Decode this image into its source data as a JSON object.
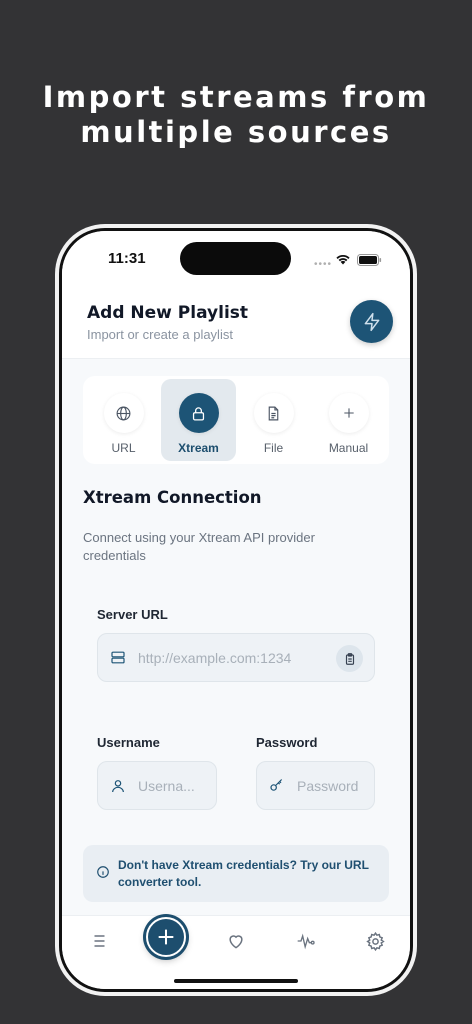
{
  "promo": {
    "line1": "Import streams from",
    "line2": "multiple sources"
  },
  "status": {
    "time": "11:31",
    "dots": "••••"
  },
  "header": {
    "title": "Add New Playlist",
    "subtitle": "Import or create a playlist",
    "action_icon": "bolt-icon"
  },
  "tabs": [
    {
      "label": "URL",
      "icon": "globe-icon",
      "active": false
    },
    {
      "label": "Xtream",
      "icon": "lock-icon",
      "active": true
    },
    {
      "label": "File",
      "icon": "file-icon",
      "active": false
    },
    {
      "label": "Manual",
      "icon": "plus-icon",
      "active": false
    }
  ],
  "section": {
    "title": "Xtream Connection",
    "description": "Connect using your Xtream API provider credentials"
  },
  "form": {
    "server_url": {
      "label": "Server URL",
      "placeholder": "http://example.com:1234"
    },
    "username": {
      "label": "Username",
      "placeholder": "Userna..."
    },
    "password": {
      "label": "Password",
      "placeholder": "Password"
    }
  },
  "info": {
    "text": "Don't have Xtream credentials? Try our URL converter tool."
  },
  "nav": [
    "list-icon",
    "add-icon",
    "heart-icon",
    "activity-icon",
    "settings-icon"
  ],
  "colors": {
    "accent": "#1d5476",
    "background": "#333335",
    "screen": "#f7f9fb"
  }
}
